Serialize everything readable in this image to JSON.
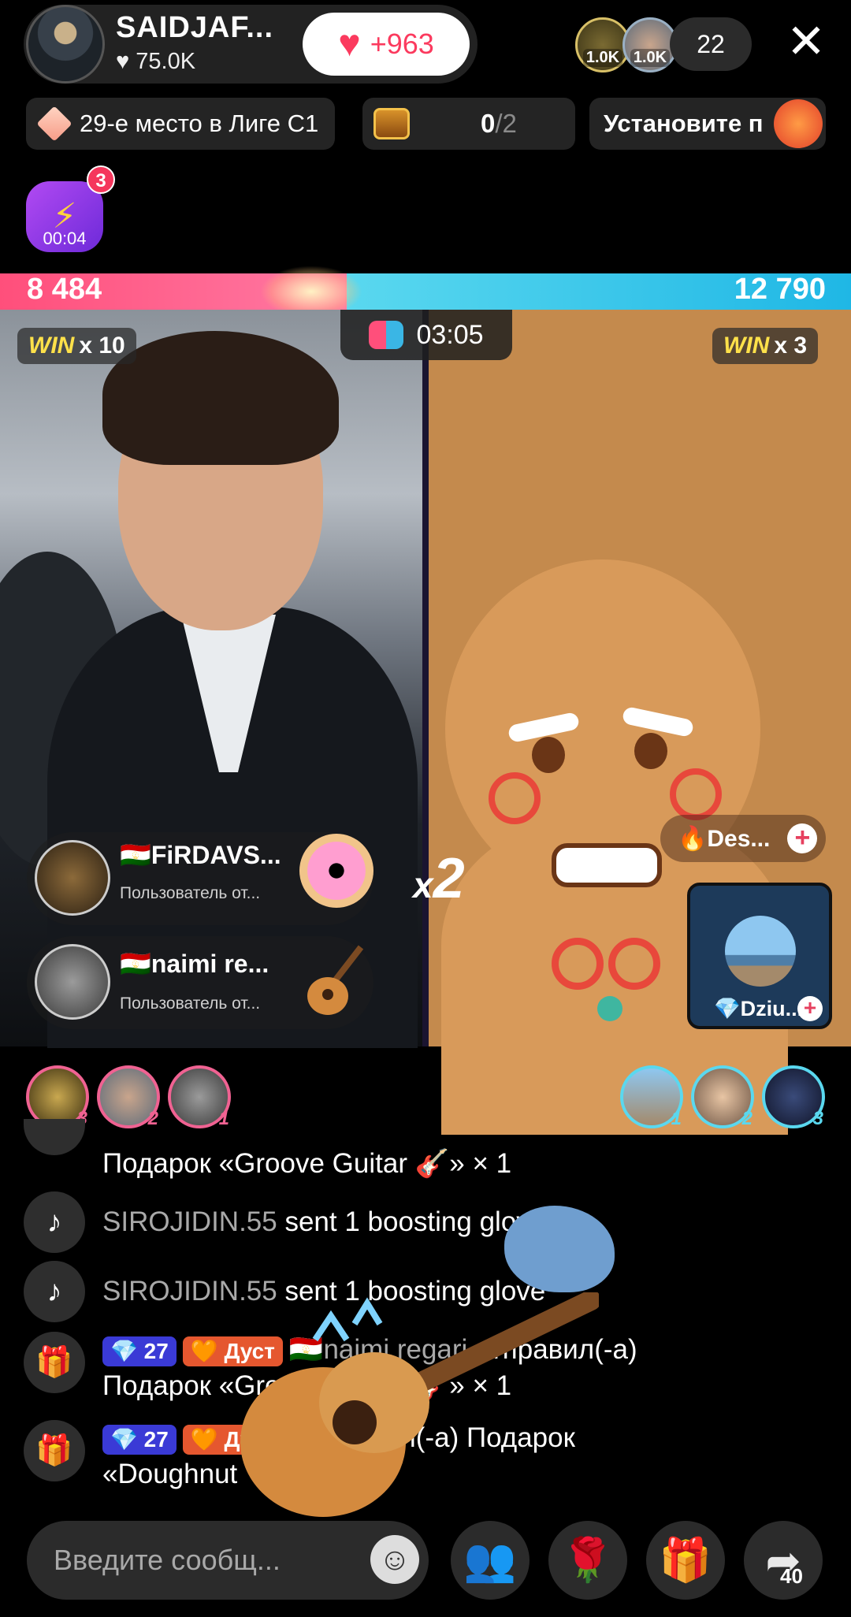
{
  "header": {
    "host_name": "SAIDJAF...",
    "host_likes": "75.0K",
    "like_count": "+963",
    "top_viewers": [
      {
        "amount": "1.0K"
      },
      {
        "amount": "1.0K"
      }
    ],
    "viewer_count": "22",
    "close": "✕"
  },
  "chips": {
    "league": "29-е место в Лиге C1",
    "chest_done": "0",
    "chest_total": "/2",
    "set_label": "Установите п"
  },
  "bolt": {
    "notification": "3",
    "timer": "00:04"
  },
  "battle": {
    "score_left": "8 484",
    "score_right": "12 790",
    "timer": "03:05",
    "left_win_label": "WIN",
    "left_win_mult": "x 10",
    "right_win_label": "WIN",
    "right_win_mult": "x 3",
    "multiplier_x": "x",
    "multiplier_val": "2"
  },
  "gifts": [
    {
      "name": "🇹🇯FiRDAVS...",
      "sub": "Пользователь  от..."
    },
    {
      "name": "🇹🇯naimi re...",
      "sub": "Пользователь  от..."
    }
  ],
  "guest": {
    "fire_name": "🔥Des...",
    "card_name": "💎Dziu..."
  },
  "ranks_left": [
    "3",
    "2",
    "1"
  ],
  "ranks_right": [
    "1",
    "2",
    "3"
  ],
  "chat": [
    {
      "text": "Подарок «Groove Guitar 🎸» × 1"
    },
    {
      "user": "SIROJIDIN.55",
      "text": " sent 1 boosting glov"
    },
    {
      "user": "SIROJIDIN.55",
      "text": " sent 1 boosting glove"
    },
    {
      "level": "💎 27",
      "fan": "🧡 Дуст",
      "user": "🇹🇯naimi regari",
      "text": " отправил(-а)",
      "text2": "Подарок «Groove Guitar 🎸» × 1"
    },
    {
      "level": "💎 27",
      "fan": "🧡 Дуст",
      "text": " отправил(-а) Подарок",
      "text2": "«Doughnut"
    }
  ],
  "footer": {
    "input_placeholder": "Введите сообщ...",
    "share_count": "40"
  },
  "colors": {
    "accent_pink": "#fb3a5e",
    "battle_left": "#ff4f7b",
    "battle_right": "#1fb7e5"
  }
}
